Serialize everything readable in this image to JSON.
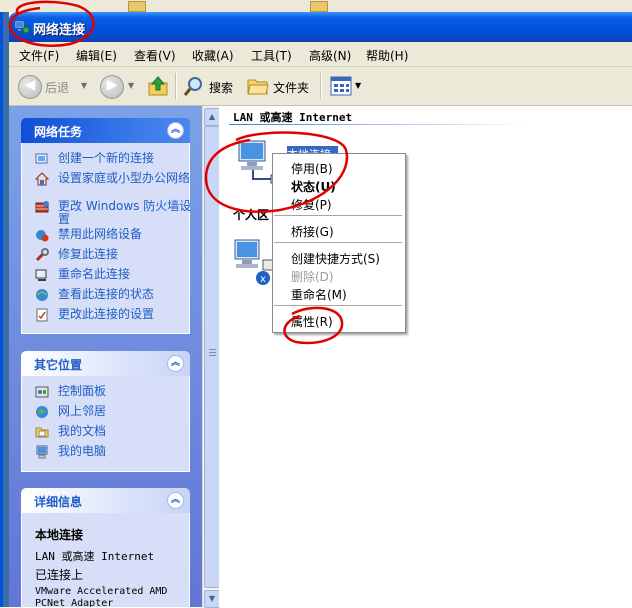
{
  "window": {
    "title": "网络连接"
  },
  "menubar": [
    {
      "label": "文件(F)"
    },
    {
      "label": "编辑(E)"
    },
    {
      "label": "查看(V)"
    },
    {
      "label": "收藏(A)"
    },
    {
      "label": "工具(T)"
    },
    {
      "label": "高级(N)"
    },
    {
      "label": "帮助(H)"
    }
  ],
  "toolbar": {
    "back_label": "后退",
    "search_label": "搜索",
    "folders_label": "文件夹"
  },
  "task_pane": {
    "network_tasks": {
      "title": "网络任务",
      "items": [
        {
          "label": "创建一个新的连接",
          "icon": "new-connection-icon"
        },
        {
          "label": "设置家庭或小型办公网络",
          "icon": "home-network-icon"
        },
        {
          "label": "更改 Windows 防火墙设置",
          "icon": "firewall-icon"
        },
        {
          "label": "禁用此网络设备",
          "icon": "disable-device-icon"
        },
        {
          "label": "修复此连接",
          "icon": "repair-icon"
        },
        {
          "label": "重命名此连接",
          "icon": "rename-icon"
        },
        {
          "label": "查看此连接的状态",
          "icon": "status-icon"
        },
        {
          "label": "更改此连接的设置",
          "icon": "settings-icon"
        }
      ]
    },
    "other_places": {
      "title": "其它位置",
      "items": [
        {
          "label": "控制面板",
          "icon": "control-panel-icon"
        },
        {
          "label": "网上邻居",
          "icon": "network-places-icon"
        },
        {
          "label": "我的文档",
          "icon": "my-documents-icon"
        },
        {
          "label": "我的电脑",
          "icon": "my-computer-icon"
        }
      ]
    },
    "details": {
      "title": "详细信息",
      "name": "本地连接",
      "type": "LAN 或高速 Internet",
      "status": "已连接上",
      "adapter_line1": "VMware Accelerated AMD",
      "adapter_line2": "PCNet Adapter"
    }
  },
  "main": {
    "group_lan": "LAN 或高速 Internet",
    "group_personal": "个人区",
    "selected_label": "本地连接"
  },
  "context_menu": {
    "items": [
      {
        "label": "停用(B)",
        "state": "normal"
      },
      {
        "label": "状态(U)",
        "state": "bold"
      },
      {
        "label": "修复(P)",
        "state": "normal"
      },
      {
        "label": "桥接(G)",
        "state": "normal"
      },
      {
        "label": "创建快捷方式(S)",
        "state": "normal"
      },
      {
        "label": "删除(D)",
        "state": "disabled"
      },
      {
        "label": "重命名(M)",
        "state": "normal"
      },
      {
        "label": "属性(R)",
        "state": "normal"
      }
    ]
  },
  "colors": {
    "title_bar": "#0052df",
    "task_pane": "#6375d6",
    "link": "#215dc6",
    "annotation": "#e00000"
  }
}
